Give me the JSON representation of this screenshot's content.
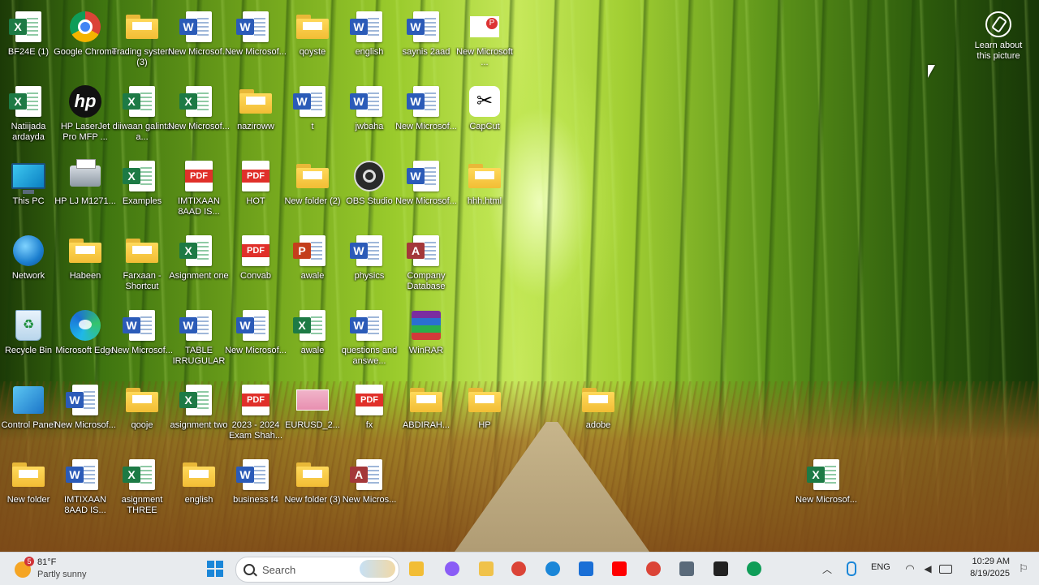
{
  "desktop": {
    "icons": [
      {
        "label": "BF24E (1)",
        "type": "excel"
      },
      {
        "label": "Google Chrome",
        "type": "chrome"
      },
      {
        "label": "Trading system (3)",
        "type": "folder"
      },
      {
        "label": "New Microsof...",
        "type": "word"
      },
      {
        "label": "New Microsof...",
        "type": "word"
      },
      {
        "label": "qoyste",
        "type": "folder"
      },
      {
        "label": "english",
        "type": "word"
      },
      {
        "label": "saynis 2aad",
        "type": "word"
      },
      {
        "label": "New Microsoft ...",
        "type": "newfile-p"
      },
      {
        "label": "Natiijada ardayda",
        "type": "excel"
      },
      {
        "label": "HP LaserJet Pro MFP ...",
        "type": "hp"
      },
      {
        "label": "diiwaan galinta a...",
        "type": "excel"
      },
      {
        "label": "New Microsof...",
        "type": "excel"
      },
      {
        "label": "naziroww",
        "type": "folder"
      },
      {
        "label": "t",
        "type": "word"
      },
      {
        "label": "jwbaha",
        "type": "word"
      },
      {
        "label": "New Microsof...",
        "type": "word"
      },
      {
        "label": "CapCut",
        "type": "capcut"
      },
      {
        "label": "This PC",
        "type": "monitor"
      },
      {
        "label": "HP LJ M1271...",
        "type": "printer"
      },
      {
        "label": "Examples",
        "type": "excel"
      },
      {
        "label": "IMTIXAAN 8AAD IS...",
        "type": "pdf"
      },
      {
        "label": "HOT",
        "type": "pdf"
      },
      {
        "label": "New folder (2)",
        "type": "folder"
      },
      {
        "label": "OBS Studio",
        "type": "obs"
      },
      {
        "label": "New Microsof...",
        "type": "word"
      },
      {
        "label": "hhh.html",
        "type": "folder"
      },
      {
        "label": "Network",
        "type": "globe"
      },
      {
        "label": "Habeen",
        "type": "folder"
      },
      {
        "label": "Farxaan - Shortcut",
        "type": "folder"
      },
      {
        "label": "Asignment one",
        "type": "excel"
      },
      {
        "label": "Convab",
        "type": "pdf"
      },
      {
        "label": "awale",
        "type": "ppt"
      },
      {
        "label": "physics",
        "type": "word"
      },
      {
        "label": "Company Database",
        "type": "access"
      },
      {
        "label": "Recycle Bin",
        "type": "bin"
      },
      {
        "label": "Microsoft Edge",
        "type": "edge"
      },
      {
        "label": "New Microsof...",
        "type": "word"
      },
      {
        "label": "TABLE IRRUGULAR",
        "type": "word"
      },
      {
        "label": "New Microsof...",
        "type": "word"
      },
      {
        "label": "awale",
        "type": "excel"
      },
      {
        "label": "questions and answe...",
        "type": "word"
      },
      {
        "label": "WinRAR",
        "type": "winrar"
      },
      {
        "label": "Control Panel",
        "type": "cpanel"
      },
      {
        "label": "New Microsof...",
        "type": "word"
      },
      {
        "label": "qooje",
        "type": "folder"
      },
      {
        "label": "asignment two",
        "type": "excel"
      },
      {
        "label": "2023 - 2024 Exam Shah...",
        "type": "pdf"
      },
      {
        "label": "EURUSD_2...",
        "type": "imgfile"
      },
      {
        "label": "fx",
        "type": "pdf"
      },
      {
        "label": "adobe",
        "type": "folder"
      },
      {
        "label": "ABDIRAH...",
        "type": "folder"
      },
      {
        "label": "HP",
        "type": "folder"
      },
      {
        "label": "New folder",
        "type": "folder"
      },
      {
        "label": "IMTIXAAN 8AAD IS...",
        "type": "word"
      },
      {
        "label": "asignment THREE",
        "type": "excel"
      },
      {
        "label": "english",
        "type": "folder"
      },
      {
        "label": "business f4",
        "type": "word"
      },
      {
        "label": "New folder (3)",
        "type": "folder"
      },
      {
        "label": "New Micros...",
        "type": "access"
      },
      {
        "label": "New Microsof...",
        "type": "excel"
      }
    ],
    "learn_label": "Learn about this picture"
  },
  "taskbar": {
    "weather": {
      "temp": "81°F",
      "desc": "Partly sunny",
      "alert_count": "5"
    },
    "search_placeholder": "Search",
    "tray": {
      "lang": "ENG",
      "time": "10:29 AM",
      "date": "8/19/2025"
    },
    "pinned": [
      {
        "name": "file-explorer",
        "color": "#f2bd35"
      },
      {
        "name": "copilot",
        "color": "#8a5cf6"
      },
      {
        "name": "explorer",
        "color": "#f0c24a"
      },
      {
        "name": "chrome",
        "color": "#db4437"
      },
      {
        "name": "edge",
        "color": "#1a86d8"
      },
      {
        "name": "store",
        "color": "#1a6fd6"
      },
      {
        "name": "youtube",
        "color": "#ff0000"
      },
      {
        "name": "chrome-2",
        "color": "#db4437"
      },
      {
        "name": "settings",
        "color": "#5a6a7a"
      },
      {
        "name": "capcut-red",
        "color": "#222222"
      },
      {
        "name": "chrome-3",
        "color": "#0f9d58"
      }
    ]
  },
  "colors": {
    "accent": "#1a86d8",
    "taskbar_bg": "#eef1f6"
  }
}
